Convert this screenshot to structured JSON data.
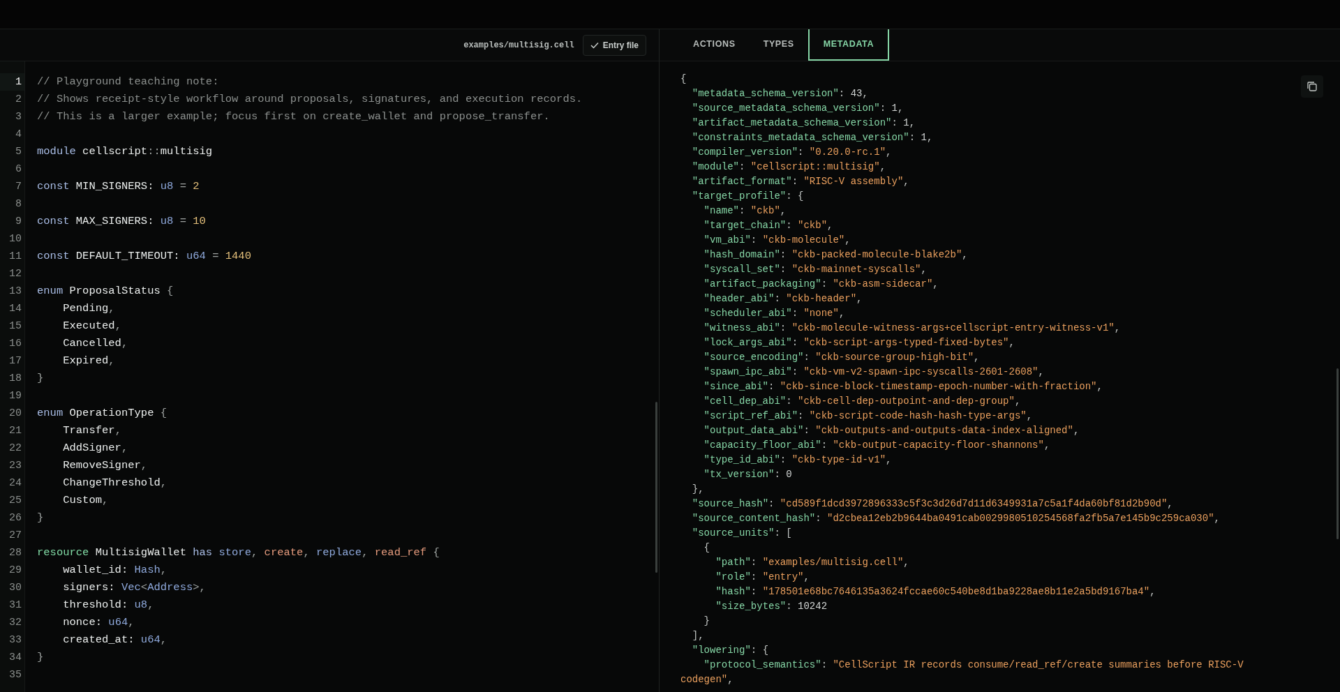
{
  "editor": {
    "file_path": "examples/multisig.cell",
    "entry_button": "Entry file",
    "lines": [
      {
        "number": "1",
        "current": true,
        "tokens": [
          {
            "kind": "comment",
            "text": "// Playground teaching note:"
          }
        ]
      },
      {
        "number": "2",
        "current": false,
        "tokens": [
          {
            "kind": "comment",
            "text": "// Shows receipt-style workflow around proposals, signatures, and execution records."
          }
        ]
      },
      {
        "number": "3",
        "current": false,
        "tokens": [
          {
            "kind": "comment",
            "text": "// This is a larger example; focus first on create_wallet and propose_transfer."
          }
        ]
      },
      {
        "number": "4",
        "current": false
      },
      {
        "number": "5",
        "current": false,
        "tokens": [
          {
            "kind": "keyword",
            "text": "module"
          },
          {
            "kind": "ident",
            "text": " cellscript"
          },
          {
            "kind": "punct",
            "text": "::"
          },
          {
            "kind": "ident",
            "text": "multisig"
          }
        ]
      },
      {
        "number": "6",
        "current": false
      },
      {
        "number": "7",
        "current": false,
        "tokens": [
          {
            "kind": "keyword",
            "text": "const"
          },
          {
            "kind": "ident",
            "text": " MIN_SIGNERS: "
          },
          {
            "kind": "type",
            "text": "u8"
          },
          {
            "kind": "punct",
            "text": " = "
          },
          {
            "kind": "number",
            "text": "2"
          }
        ]
      },
      {
        "number": "8",
        "current": false
      },
      {
        "number": "9",
        "current": false,
        "tokens": [
          {
            "kind": "keyword",
            "text": "const"
          },
          {
            "kind": "ident",
            "text": " MAX_SIGNERS: "
          },
          {
            "kind": "type",
            "text": "u8"
          },
          {
            "kind": "punct",
            "text": " = "
          },
          {
            "kind": "number",
            "text": "10"
          }
        ]
      },
      {
        "number": "10",
        "current": false
      },
      {
        "number": "11",
        "current": false,
        "tokens": [
          {
            "kind": "keyword",
            "text": "const"
          },
          {
            "kind": "ident",
            "text": " DEFAULT_TIMEOUT: "
          },
          {
            "kind": "type",
            "text": "u64"
          },
          {
            "kind": "punct",
            "text": " = "
          },
          {
            "kind": "number",
            "text": "1440"
          }
        ]
      },
      {
        "number": "12",
        "current": false
      },
      {
        "number": "13",
        "current": false,
        "tokens": [
          {
            "kind": "keyword",
            "text": "enum"
          },
          {
            "kind": "ident",
            "text": " ProposalStatus "
          },
          {
            "kind": "punct",
            "text": "{"
          }
        ]
      },
      {
        "number": "14",
        "current": false,
        "tokens": [
          {
            "kind": "ident",
            "text": "    Pending"
          },
          {
            "kind": "punct",
            "text": ","
          }
        ]
      },
      {
        "number": "15",
        "current": false,
        "tokens": [
          {
            "kind": "ident",
            "text": "    Executed"
          },
          {
            "kind": "punct",
            "text": ","
          }
        ]
      },
      {
        "number": "16",
        "current": false,
        "tokens": [
          {
            "kind": "ident",
            "text": "    Cancelled"
          },
          {
            "kind": "punct",
            "text": ","
          }
        ]
      },
      {
        "number": "17",
        "current": false,
        "tokens": [
          {
            "kind": "ident",
            "text": "    Expired"
          },
          {
            "kind": "punct",
            "text": ","
          }
        ]
      },
      {
        "number": "18",
        "current": false,
        "tokens": [
          {
            "kind": "punct",
            "text": "}"
          }
        ]
      },
      {
        "number": "19",
        "current": false
      },
      {
        "number": "20",
        "current": false,
        "tokens": [
          {
            "kind": "keyword",
            "text": "enum"
          },
          {
            "kind": "ident",
            "text": " OperationType "
          },
          {
            "kind": "punct",
            "text": "{"
          }
        ]
      },
      {
        "number": "21",
        "current": false,
        "tokens": [
          {
            "kind": "ident",
            "text": "    Transfer"
          },
          {
            "kind": "punct",
            "text": ","
          }
        ]
      },
      {
        "number": "22",
        "current": false,
        "tokens": [
          {
            "kind": "ident",
            "text": "    AddSigner"
          },
          {
            "kind": "punct",
            "text": ","
          }
        ]
      },
      {
        "number": "23",
        "current": false,
        "tokens": [
          {
            "kind": "ident",
            "text": "    RemoveSigner"
          },
          {
            "kind": "punct",
            "text": ","
          }
        ]
      },
      {
        "number": "24",
        "current": false,
        "tokens": [
          {
            "kind": "ident",
            "text": "    ChangeThreshold"
          },
          {
            "kind": "punct",
            "text": ","
          }
        ]
      },
      {
        "number": "25",
        "current": false,
        "tokens": [
          {
            "kind": "ident",
            "text": "    Custom"
          },
          {
            "kind": "punct",
            "text": ","
          }
        ]
      },
      {
        "number": "26",
        "current": false,
        "tokens": [
          {
            "kind": "punct",
            "text": "}"
          }
        ]
      },
      {
        "number": "27",
        "current": false
      },
      {
        "number": "28",
        "current": false,
        "tokens": [
          {
            "kind": "resource",
            "text": "resource"
          },
          {
            "kind": "ident",
            "text": " MultisigWallet "
          },
          {
            "kind": "keyword",
            "text": "has"
          },
          {
            "kind": "ability",
            "text": " store"
          },
          {
            "kind": "punct",
            "text": ", "
          },
          {
            "kind": "effect",
            "text": "create"
          },
          {
            "kind": "punct",
            "text": ", "
          },
          {
            "kind": "ability",
            "text": "replace"
          },
          {
            "kind": "punct",
            "text": ", "
          },
          {
            "kind": "effect",
            "text": "read_ref"
          },
          {
            "kind": "punct",
            "text": " {"
          }
        ]
      },
      {
        "number": "29",
        "current": false,
        "tokens": [
          {
            "kind": "ident",
            "text": "    wallet_id: "
          },
          {
            "kind": "type",
            "text": "Hash"
          },
          {
            "kind": "punct",
            "text": ","
          }
        ]
      },
      {
        "number": "30",
        "current": false,
        "tokens": [
          {
            "kind": "ident",
            "text": "    signers: "
          },
          {
            "kind": "type",
            "text": "Vec"
          },
          {
            "kind": "punct",
            "text": "<"
          },
          {
            "kind": "type",
            "text": "Address"
          },
          {
            "kind": "punct",
            "text": ">,"
          }
        ]
      },
      {
        "number": "31",
        "current": false,
        "tokens": [
          {
            "kind": "ident",
            "text": "    threshold: "
          },
          {
            "kind": "type",
            "text": "u8"
          },
          {
            "kind": "punct",
            "text": ","
          }
        ]
      },
      {
        "number": "32",
        "current": false,
        "tokens": [
          {
            "kind": "ident",
            "text": "    nonce: "
          },
          {
            "kind": "type",
            "text": "u64"
          },
          {
            "kind": "punct",
            "text": ","
          }
        ]
      },
      {
        "number": "33",
        "current": false,
        "tokens": [
          {
            "kind": "ident",
            "text": "    created_at: "
          },
          {
            "kind": "type",
            "text": "u64"
          },
          {
            "kind": "punct",
            "text": ","
          }
        ]
      },
      {
        "number": "34",
        "current": false,
        "tokens": [
          {
            "kind": "punct",
            "text": "}"
          }
        ]
      },
      {
        "number": "35",
        "current": false
      }
    ]
  },
  "inspector": {
    "tabs": [
      {
        "label": "ACTIONS",
        "selected": false
      },
      {
        "label": "TYPES",
        "selected": false
      },
      {
        "label": "METADATA",
        "selected": true
      }
    ],
    "lines": [
      [
        {
          "kind": "punct",
          "text": "{"
        }
      ],
      [
        {
          "kind": "key",
          "text": "  \"metadata_schema_version\""
        },
        {
          "kind": "punct",
          "text": ": "
        },
        {
          "kind": "number",
          "text": "43"
        },
        {
          "kind": "punct",
          "text": ","
        }
      ],
      [
        {
          "kind": "key",
          "text": "  \"source_metadata_schema_version\""
        },
        {
          "kind": "punct",
          "text": ": "
        },
        {
          "kind": "number",
          "text": "1"
        },
        {
          "kind": "punct",
          "text": ","
        }
      ],
      [
        {
          "kind": "key",
          "text": "  \"artifact_metadata_schema_version\""
        },
        {
          "kind": "punct",
          "text": ": "
        },
        {
          "kind": "number",
          "text": "1"
        },
        {
          "kind": "punct",
          "text": ","
        }
      ],
      [
        {
          "kind": "key",
          "text": "  \"constraints_metadata_schema_version\""
        },
        {
          "kind": "punct",
          "text": ": "
        },
        {
          "kind": "number",
          "text": "1"
        },
        {
          "kind": "punct",
          "text": ","
        }
      ],
      [
        {
          "kind": "key",
          "text": "  \"compiler_version\""
        },
        {
          "kind": "punct",
          "text": ": "
        },
        {
          "kind": "string",
          "text": "\"0.20.0-rc.1\""
        },
        {
          "kind": "punct",
          "text": ","
        }
      ],
      [
        {
          "kind": "key",
          "text": "  \"module\""
        },
        {
          "kind": "punct",
          "text": ": "
        },
        {
          "kind": "string",
          "text": "\"cellscript::multisig\""
        },
        {
          "kind": "punct",
          "text": ","
        }
      ],
      [
        {
          "kind": "key",
          "text": "  \"artifact_format\""
        },
        {
          "kind": "punct",
          "text": ": "
        },
        {
          "kind": "string",
          "text": "\"RISC-V assembly\""
        },
        {
          "kind": "punct",
          "text": ","
        }
      ],
      [
        {
          "kind": "key",
          "text": "  \"target_profile\""
        },
        {
          "kind": "punct",
          "text": ": {"
        }
      ],
      [
        {
          "kind": "key",
          "text": "    \"name\""
        },
        {
          "kind": "punct",
          "text": ": "
        },
        {
          "kind": "string",
          "text": "\"ckb\""
        },
        {
          "kind": "punct",
          "text": ","
        }
      ],
      [
        {
          "kind": "key",
          "text": "    \"target_chain\""
        },
        {
          "kind": "punct",
          "text": ": "
        },
        {
          "kind": "string",
          "text": "\"ckb\""
        },
        {
          "kind": "punct",
          "text": ","
        }
      ],
      [
        {
          "kind": "key",
          "text": "    \"vm_abi\""
        },
        {
          "kind": "punct",
          "text": ": "
        },
        {
          "kind": "string",
          "text": "\"ckb-molecule\""
        },
        {
          "kind": "punct",
          "text": ","
        }
      ],
      [
        {
          "kind": "key",
          "text": "    \"hash_domain\""
        },
        {
          "kind": "punct",
          "text": ": "
        },
        {
          "kind": "string",
          "text": "\"ckb-packed-molecule-blake2b\""
        },
        {
          "kind": "punct",
          "text": ","
        }
      ],
      [
        {
          "kind": "key",
          "text": "    \"syscall_set\""
        },
        {
          "kind": "punct",
          "text": ": "
        },
        {
          "kind": "string",
          "text": "\"ckb-mainnet-syscalls\""
        },
        {
          "kind": "punct",
          "text": ","
        }
      ],
      [
        {
          "kind": "key",
          "text": "    \"artifact_packaging\""
        },
        {
          "kind": "punct",
          "text": ": "
        },
        {
          "kind": "string",
          "text": "\"ckb-asm-sidecar\""
        },
        {
          "kind": "punct",
          "text": ","
        }
      ],
      [
        {
          "kind": "key",
          "text": "    \"header_abi\""
        },
        {
          "kind": "punct",
          "text": ": "
        },
        {
          "kind": "string",
          "text": "\"ckb-header\""
        },
        {
          "kind": "punct",
          "text": ","
        }
      ],
      [
        {
          "kind": "key",
          "text": "    \"scheduler_abi\""
        },
        {
          "kind": "punct",
          "text": ": "
        },
        {
          "kind": "string",
          "text": "\"none\""
        },
        {
          "kind": "punct",
          "text": ","
        }
      ],
      [
        {
          "kind": "key",
          "text": "    \"witness_abi\""
        },
        {
          "kind": "punct",
          "text": ": "
        },
        {
          "kind": "string",
          "text": "\"ckb-molecule-witness-args+cellscript-entry-witness-v1\""
        },
        {
          "kind": "punct",
          "text": ","
        }
      ],
      [
        {
          "kind": "key",
          "text": "    \"lock_args_abi\""
        },
        {
          "kind": "punct",
          "text": ": "
        },
        {
          "kind": "string",
          "text": "\"ckb-script-args-typed-fixed-bytes\""
        },
        {
          "kind": "punct",
          "text": ","
        }
      ],
      [
        {
          "kind": "key",
          "text": "    \"source_encoding\""
        },
        {
          "kind": "punct",
          "text": ": "
        },
        {
          "kind": "string",
          "text": "\"ckb-source-group-high-bit\""
        },
        {
          "kind": "punct",
          "text": ","
        }
      ],
      [
        {
          "kind": "key",
          "text": "    \"spawn_ipc_abi\""
        },
        {
          "kind": "punct",
          "text": ": "
        },
        {
          "kind": "string",
          "text": "\"ckb-vm-v2-spawn-ipc-syscalls-2601-2608\""
        },
        {
          "kind": "punct",
          "text": ","
        }
      ],
      [
        {
          "kind": "key",
          "text": "    \"since_abi\""
        },
        {
          "kind": "punct",
          "text": ": "
        },
        {
          "kind": "string",
          "text": "\"ckb-since-block-timestamp-epoch-number-with-fraction\""
        },
        {
          "kind": "punct",
          "text": ","
        }
      ],
      [
        {
          "kind": "key",
          "text": "    \"cell_dep_abi\""
        },
        {
          "kind": "punct",
          "text": ": "
        },
        {
          "kind": "string",
          "text": "\"ckb-cell-dep-outpoint-and-dep-group\""
        },
        {
          "kind": "punct",
          "text": ","
        }
      ],
      [
        {
          "kind": "key",
          "text": "    \"script_ref_abi\""
        },
        {
          "kind": "punct",
          "text": ": "
        },
        {
          "kind": "string",
          "text": "\"ckb-script-code-hash-hash-type-args\""
        },
        {
          "kind": "punct",
          "text": ","
        }
      ],
      [
        {
          "kind": "key",
          "text": "    \"output_data_abi\""
        },
        {
          "kind": "punct",
          "text": ": "
        },
        {
          "kind": "string",
          "text": "\"ckb-outputs-and-outputs-data-index-aligned\""
        },
        {
          "kind": "punct",
          "text": ","
        }
      ],
      [
        {
          "kind": "key",
          "text": "    \"capacity_floor_abi\""
        },
        {
          "kind": "punct",
          "text": ": "
        },
        {
          "kind": "string",
          "text": "\"ckb-output-capacity-floor-shannons\""
        },
        {
          "kind": "punct",
          "text": ","
        }
      ],
      [
        {
          "kind": "key",
          "text": "    \"type_id_abi\""
        },
        {
          "kind": "punct",
          "text": ": "
        },
        {
          "kind": "string",
          "text": "\"ckb-type-id-v1\""
        },
        {
          "kind": "punct",
          "text": ","
        }
      ],
      [
        {
          "kind": "key",
          "text": "    \"tx_version\""
        },
        {
          "kind": "punct",
          "text": ": "
        },
        {
          "kind": "number",
          "text": "0"
        }
      ],
      [
        {
          "kind": "punct",
          "text": "  },"
        }
      ],
      [
        {
          "kind": "key",
          "text": "  \"source_hash\""
        },
        {
          "kind": "punct",
          "text": ": "
        },
        {
          "kind": "string",
          "text": "\"cd589f1dcd3972896333c5f3c3d26d7d11d6349931a7c5a1f4da60bf81d2b90d\""
        },
        {
          "kind": "punct",
          "text": ","
        }
      ],
      [
        {
          "kind": "key",
          "text": "  \"source_content_hash\""
        },
        {
          "kind": "punct",
          "text": ": "
        },
        {
          "kind": "string",
          "text": "\"d2cbea12eb2b9644ba0491cab0029980510254568fa2fb5a7e145b9c259ca030\""
        },
        {
          "kind": "punct",
          "text": ","
        }
      ],
      [
        {
          "kind": "key",
          "text": "  \"source_units\""
        },
        {
          "kind": "punct",
          "text": ": ["
        }
      ],
      [
        {
          "kind": "punct",
          "text": "    {"
        }
      ],
      [
        {
          "kind": "key",
          "text": "      \"path\""
        },
        {
          "kind": "punct",
          "text": ": "
        },
        {
          "kind": "string",
          "text": "\"examples/multisig.cell\""
        },
        {
          "kind": "punct",
          "text": ","
        }
      ],
      [
        {
          "kind": "key",
          "text": "      \"role\""
        },
        {
          "kind": "punct",
          "text": ": "
        },
        {
          "kind": "string",
          "text": "\"entry\""
        },
        {
          "kind": "punct",
          "text": ","
        }
      ],
      [
        {
          "kind": "key",
          "text": "      \"hash\""
        },
        {
          "kind": "punct",
          "text": ": "
        },
        {
          "kind": "string",
          "text": "\"178501e68bc7646135a3624fccae60c540be8d1ba9228ae8b11e2a5bd9167ba4\""
        },
        {
          "kind": "punct",
          "text": ","
        }
      ],
      [
        {
          "kind": "key",
          "text": "      \"size_bytes\""
        },
        {
          "kind": "punct",
          "text": ": "
        },
        {
          "kind": "number",
          "text": "10242"
        }
      ],
      [
        {
          "kind": "punct",
          "text": "    }"
        }
      ],
      [
        {
          "kind": "punct",
          "text": "  ],"
        }
      ],
      [
        {
          "kind": "key",
          "text": "  \"lowering\""
        },
        {
          "kind": "punct",
          "text": ": {"
        }
      ],
      [
        {
          "kind": "key",
          "text": "    \"protocol_semantics\""
        },
        {
          "kind": "punct",
          "text": ": "
        },
        {
          "kind": "string",
          "text": "\"CellScript IR records consume/read_ref/create summaries before RISC-V codegen\""
        },
        {
          "kind": "punct",
          "text": ","
        }
      ]
    ]
  }
}
